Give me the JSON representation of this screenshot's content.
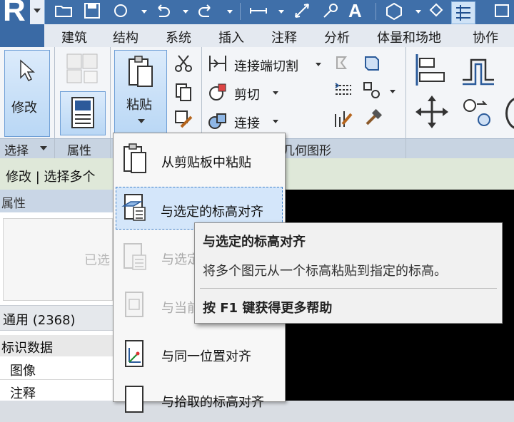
{
  "app": {
    "logo_letter": "R"
  },
  "quick_access": {
    "icons": [
      "open-folder-icon",
      "save-icon",
      "sync-icon",
      "undo-icon",
      "redo-icon",
      "measure-icon",
      "dimension-icon",
      "tag-icon",
      "text-icon",
      "3d-view-icon",
      "section-icon",
      "thin-lines-icon",
      "close-hidden-icon"
    ],
    "text_tool_label": "A"
  },
  "tabs": [
    "建筑",
    "结构",
    "系统",
    "插入",
    "注释",
    "分析",
    "体量和场地",
    "协作"
  ],
  "ribbon": {
    "modify_label": "修改",
    "paste_label": "粘贴",
    "cut_join_label": "连接端切割",
    "cut_label": "剪切",
    "join_label": "连接",
    "panels": {
      "select": "选择",
      "properties": "属性",
      "geometry": "几何图形"
    }
  },
  "options_bar": {
    "text": "修改 | 选择多个"
  },
  "properties": {
    "title": "属性",
    "type_text": "已选",
    "common_label": "通用 (2368)",
    "group_label": "标识数据",
    "rows": [
      "图像",
      "注释"
    ]
  },
  "paste_menu": {
    "items": [
      {
        "label": "从剪贴板中粘贴",
        "enabled": true,
        "icon": "clipboard-icon"
      },
      {
        "label": "与选定的标高对齐",
        "enabled": true,
        "icon": "align-selected-levels-icon",
        "selected": true
      },
      {
        "label": "与选定",
        "enabled": false,
        "icon": "align-selected-views-icon"
      },
      {
        "label": "与当前",
        "enabled": false,
        "icon": "align-current-view-icon"
      },
      {
        "label": "与同一位置对齐",
        "enabled": true,
        "icon": "align-same-place-icon"
      },
      {
        "label": "与拾取的标高对齐",
        "enabled": true,
        "icon": "align-picked-level-icon"
      }
    ]
  },
  "tooltip": {
    "title": "与选定的标高对齐",
    "description": "将多个图元从一个标高粘贴到指定的标高。",
    "help": "按 F1 键获得更多帮助"
  },
  "colors": {
    "title_bar": "#3f6fa9",
    "selection": "#d4e6fa",
    "canvas": "#000000"
  }
}
